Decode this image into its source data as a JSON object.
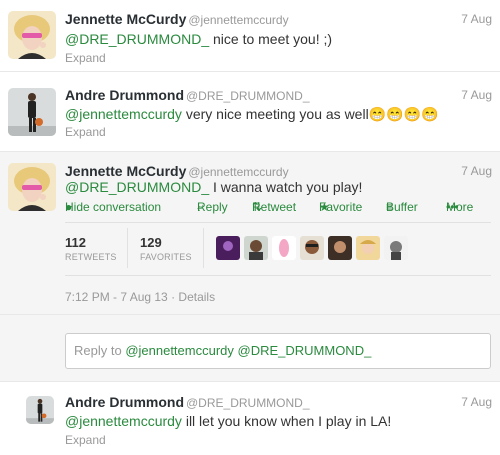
{
  "tweets": [
    {
      "name": "Jennette McCurdy",
      "handle": "@jennettemccurdy",
      "time": "7 Aug",
      "mention": "@DRE_DRUMMOND_",
      "text": " nice to meet you! ;)",
      "expand": "Expand"
    },
    {
      "name": "Andre Drummond",
      "handle": "@DRE_DRUMMOND_",
      "time": "7 Aug",
      "mention": "@jennettemccurdy",
      "text": " very nice meeting you as well",
      "emoji": "😁😁😁😁",
      "expand": "Expand"
    },
    {
      "name": "Jennette McCurdy",
      "handle": "@jennettemccurdy",
      "time": "7 Aug",
      "mention": "@DRE_DRUMMOND_",
      "text": " I wanna watch you play!",
      "actions": {
        "hide": "Hide conversation",
        "reply": "Reply",
        "retweet": "Retweet",
        "favorite": "Favorite",
        "buffer": "Buffer",
        "more": "More"
      },
      "stats": {
        "retweets_count": "112",
        "retweets_label": "RETWEETS",
        "favorites_count": "129",
        "favorites_label": "FAVORITES"
      },
      "timestamp": "7:12 PM - 7 Aug 13",
      "details_sep": " · ",
      "details": "Details"
    },
    {
      "name": "Andre Drummond",
      "handle": "@DRE_DRUMMOND_",
      "time": "7 Aug",
      "mention": "@jennettemccurdy",
      "text": " ill let you know when I play in LA!",
      "expand": "Expand"
    }
  ],
  "reply_box": {
    "prefix": "Reply to ",
    "mention1": "@jennettemccurdy",
    "mention2": " @DRE_DRUMMOND_"
  },
  "colors": {
    "link": "#2a8a3e",
    "meta": "#999999"
  }
}
